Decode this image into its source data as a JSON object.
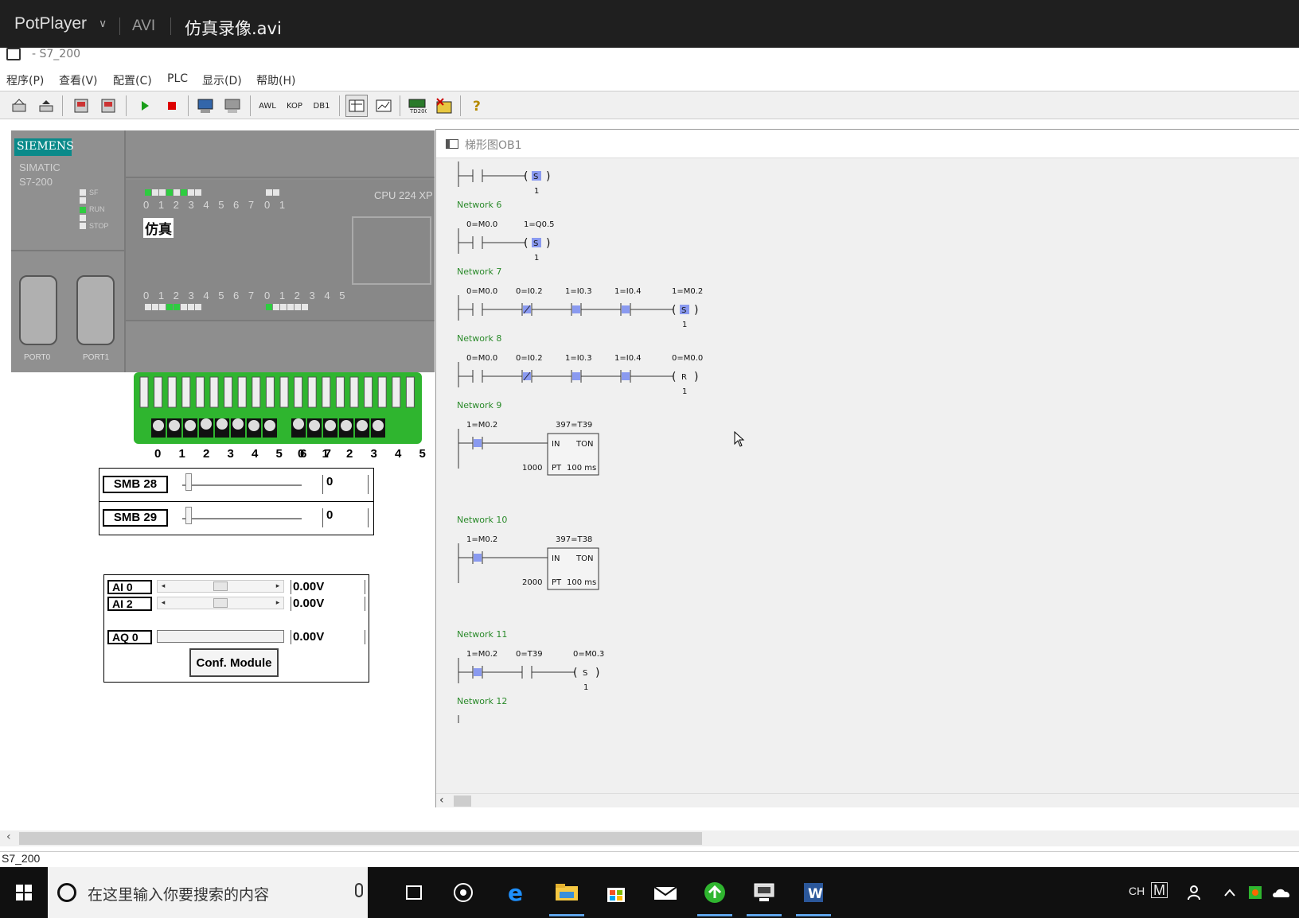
{
  "player": {
    "name": "PotPlayer",
    "caret": "∨",
    "format": "AVI",
    "filename": "仿真录像.avi"
  },
  "app": {
    "title": "- S7_200"
  },
  "menu": [
    "程序(P)",
    "查看(V)",
    "配置(C)",
    "PLC",
    "显示(D)",
    "帮助(H)"
  ],
  "toolbar": {
    "awl": "AWL",
    "kop": "KOP",
    "db1": "DB1"
  },
  "plc": {
    "brand": "SIEMENS",
    "model_line1": "SIMATIC",
    "model_line2": "S7-200",
    "led_sf": "SF",
    "led_run": "RUN",
    "led_stop": "STOP",
    "cpu": "CPU 224 XP",
    "sim_label": "仿真",
    "top_nums_a": "0 1 2 3 4 5 6 7",
    "top_nums_b": "0 1",
    "bot_nums_a": "0 1 2 3 4 5 6 7",
    "bot_nums_b": "0 1 2 3 4 5",
    "port0": "PORT0",
    "port1": "PORT1",
    "inputs_top_on": [
      1,
      0,
      0,
      1,
      0,
      1,
      0,
      0
    ],
    "outputs_bot_on": [
      0,
      0,
      0,
      1,
      1,
      0,
      0,
      0
    ],
    "outputs_bot_b_on": [
      1,
      0,
      0,
      0,
      0,
      0
    ]
  },
  "terminal": {
    "nums_a": "0 1 2 3 4 5 6 7",
    "nums_b": "0 1 2 3 4 5"
  },
  "smb": [
    {
      "label": "SMB 28",
      "value": "0"
    },
    {
      "label": "SMB 29",
      "value": "0"
    }
  ],
  "analog": {
    "ai0_label": "AI 0",
    "ai0_value": "0.00V",
    "ai2_label": "AI 2",
    "ai2_value": "0.00V",
    "aq0_label": "AQ 0",
    "aq0_value": "0.00V",
    "conf_button": "Conf. Module"
  },
  "ladder": {
    "title": "梯形图OB1",
    "networks": [
      {
        "label": "",
        "contacts": [],
        "coil": {
          "type": "S",
          "addr": "",
          "active": true,
          "n": "1"
        }
      },
      {
        "label": "Network 6",
        "contacts": [
          {
            "addr": "0=M0.0",
            "active": false,
            "neg": false
          }
        ],
        "coil": {
          "type": "S",
          "addr": "1=Q0.5",
          "active": true,
          "n": "1"
        }
      },
      {
        "label": "Network 7",
        "contacts": [
          {
            "addr": "0=M0.0",
            "active": false,
            "neg": false
          },
          {
            "addr": "0=I0.2",
            "active": true,
            "neg": true
          },
          {
            "addr": "1=I0.3",
            "active": true,
            "neg": false
          },
          {
            "addr": "1=I0.4",
            "active": true,
            "neg": false
          }
        ],
        "coil": {
          "type": "S",
          "addr": "1=M0.2",
          "active": true,
          "n": "1"
        }
      },
      {
        "label": "Network 8",
        "contacts": [
          {
            "addr": "0=M0.0",
            "active": false,
            "neg": false
          },
          {
            "addr": "0=I0.2",
            "active": true,
            "neg": true
          },
          {
            "addr": "1=I0.3",
            "active": true,
            "neg": false
          },
          {
            "addr": "1=I0.4",
            "active": true,
            "neg": false
          }
        ],
        "coil": {
          "type": "R",
          "addr": "0=M0.0",
          "active": false,
          "n": "1"
        }
      },
      {
        "label": "Network 9",
        "contacts": [
          {
            "addr": "1=M0.2",
            "active": true,
            "neg": false
          }
        ],
        "timer": {
          "addr": "397=T39",
          "in": "IN",
          "type": "TON",
          "pt_label": "PT",
          "base": "100 ms",
          "pt": "1000"
        }
      },
      {
        "label": "Network 10",
        "contacts": [
          {
            "addr": "1=M0.2",
            "active": true,
            "neg": false
          }
        ],
        "timer": {
          "addr": "397=T38",
          "in": "IN",
          "type": "TON",
          "pt_label": "PT",
          "base": "100 ms",
          "pt": "2000"
        }
      },
      {
        "label": "Network 11",
        "contacts": [
          {
            "addr": "1=M0.2",
            "active": true,
            "neg": false
          },
          {
            "addr": "0=T39",
            "active": false,
            "neg": false
          }
        ],
        "coil": {
          "type": "S",
          "addr": "0=M0.3",
          "active": false,
          "n": "1"
        }
      },
      {
        "label": "Network 12",
        "contacts": []
      }
    ]
  },
  "status": {
    "text": "S7_200"
  },
  "taskbar": {
    "search_placeholder": "在这里输入你要搜索的内容",
    "tray_lang": "CH",
    "tray_ime": "M"
  }
}
